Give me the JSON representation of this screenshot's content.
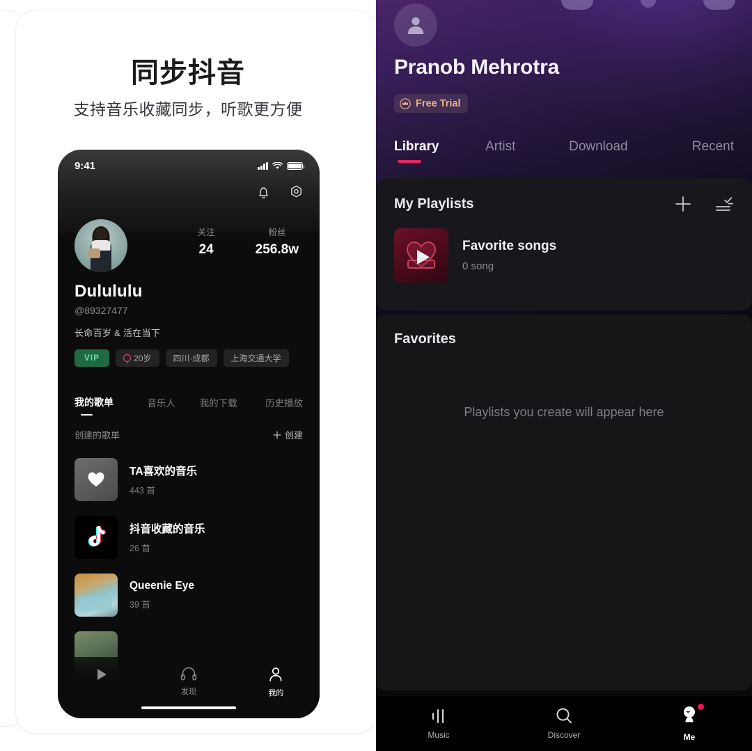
{
  "promo": {
    "title": "同步抖音",
    "subtitle": "支持音乐收藏同步，听歌更方便"
  },
  "phone_left": {
    "status": {
      "time": "9:41",
      "signal_icon": "signal-bars-icon",
      "wifi_icon": "wifi-icon",
      "battery_icon": "battery-icon"
    },
    "header_actions": [
      {
        "name": "bell-icon",
        "label": "通知"
      },
      {
        "name": "gear-icon",
        "label": "设置"
      }
    ],
    "profile": {
      "avatar_name": "user-avatar",
      "username": "Dulululu",
      "handle": "@89327477",
      "bio": "长命百岁 & 活在当下",
      "stats": [
        {
          "label": "关注",
          "value": "24"
        },
        {
          "label": "粉丝",
          "value": "256.8w"
        }
      ],
      "tags": [
        {
          "text": "VIP",
          "type": "vip"
        },
        {
          "text": "20岁",
          "type": "gender"
        },
        {
          "text": "四川·成都",
          "type": "plain"
        },
        {
          "text": "上海交通大学",
          "type": "plain"
        }
      ]
    },
    "tabs": [
      {
        "label": "我的歌单",
        "active": true
      },
      {
        "label": "音乐人",
        "active": false
      },
      {
        "label": "我的下载",
        "active": false
      },
      {
        "label": "历史播放",
        "active": false
      }
    ],
    "section": {
      "label": "创建的歌单",
      "create_label": "创建",
      "create_icon": "plus-icon"
    },
    "playlists": [
      {
        "title": "TA喜欢的音乐",
        "count": "443 首",
        "thumb": "heart"
      },
      {
        "title": "抖音收藏的音乐",
        "count": "26 首",
        "thumb": "tiktok"
      },
      {
        "title": "Queenie Eye",
        "count": "39 首",
        "thumb": "photo1"
      }
    ],
    "nav": [
      {
        "label": "",
        "icon": "play-icon",
        "active": false
      },
      {
        "label": "发现",
        "icon": "headphones-icon",
        "active": false
      },
      {
        "label": "我的",
        "icon": "person-icon",
        "active": true
      }
    ]
  },
  "app_right": {
    "user": {
      "name": "Pranob Mehrotra",
      "avatar_icon": "person-avatar-icon",
      "badge": {
        "label": "Free Trial",
        "icon": "crown-icon"
      }
    },
    "tabs": [
      {
        "label": "Library",
        "active": true
      },
      {
        "label": "Artist",
        "active": false
      },
      {
        "label": "Download",
        "active": false
      },
      {
        "label": "Recent",
        "active": false
      }
    ],
    "playlists_section": {
      "title": "My Playlists",
      "actions": [
        {
          "name": "plus-icon",
          "label": "Add"
        },
        {
          "name": "sort-icon",
          "label": "Sort"
        }
      ],
      "items": [
        {
          "title": "Favorite songs",
          "count": "0 song",
          "art": "heart-play"
        }
      ]
    },
    "favorites_section": {
      "title": "Favorites",
      "empty_text": "Playlists you create will appear here"
    },
    "bottom_nav": [
      {
        "label": "Music",
        "icon": "equalizer-icon",
        "active": false
      },
      {
        "label": "Discover",
        "icon": "search-icon",
        "active": false
      },
      {
        "label": "Me",
        "icon": "me-avatar-icon",
        "active": true,
        "badge": true
      }
    ]
  },
  "colors": {
    "accent_pink": "#e0275e",
    "vip_green": "#6ee0a3",
    "trial_orange": "#e8b185",
    "nav_dot": "#e8174f"
  }
}
